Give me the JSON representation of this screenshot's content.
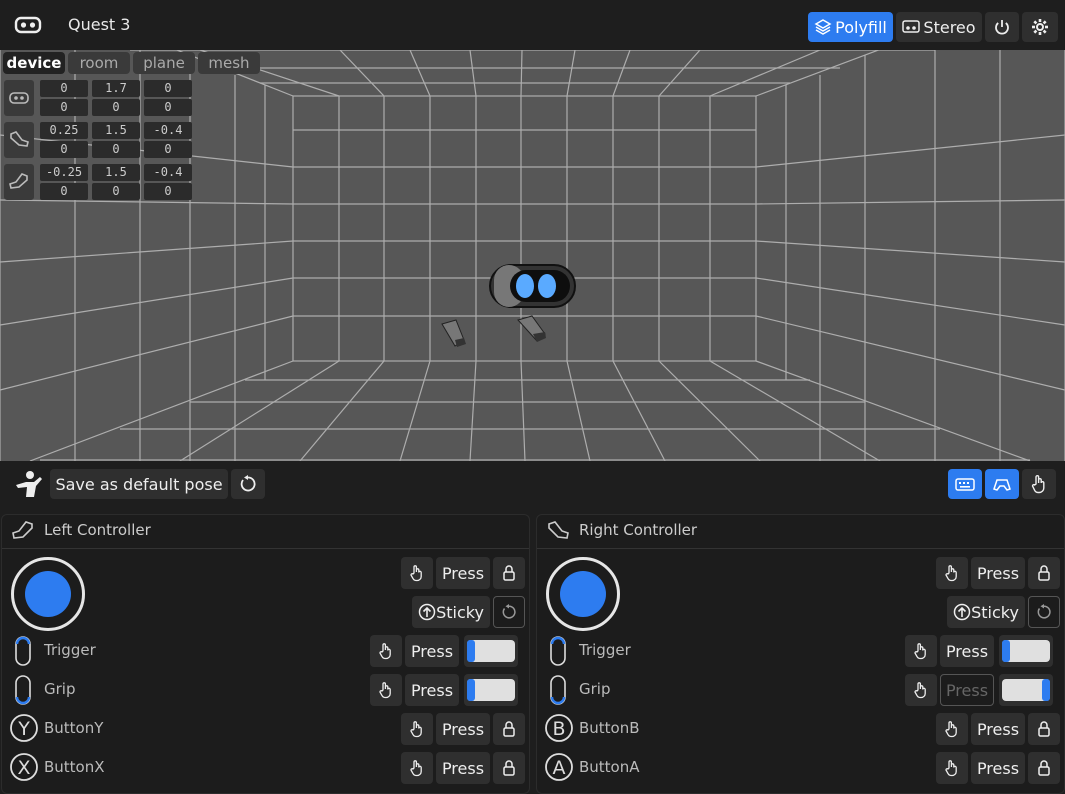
{
  "header": {
    "device_name": "Quest 3",
    "polyfill_label": "Polyfill",
    "stereo_label": "Stereo"
  },
  "viewport_tabs": [
    "device",
    "room",
    "plane",
    "mesh"
  ],
  "poses": [
    {
      "name": "headset",
      "pos": [
        "0",
        "1.7",
        "0"
      ],
      "rot": [
        "0",
        "0",
        "0"
      ]
    },
    {
      "name": "right-controller",
      "pos": [
        "0.25",
        "1.5",
        "-0.4"
      ],
      "rot": [
        "0",
        "0",
        "0"
      ]
    },
    {
      "name": "left-controller",
      "pos": [
        "-0.25",
        "1.5",
        "-0.4"
      ],
      "rot": [
        "0",
        "0",
        "0"
      ]
    }
  ],
  "pose_bar": {
    "save_label": "Save as default pose"
  },
  "left": {
    "title": "Left Controller",
    "press": "Press",
    "sticky": "Sticky",
    "buttons": [
      {
        "label": "Trigger",
        "value": 0
      },
      {
        "label": "Grip",
        "value": 0
      },
      {
        "label": "ButtonY",
        "letter": "Y"
      },
      {
        "label": "ButtonX",
        "letter": "X"
      }
    ]
  },
  "right": {
    "title": "Right Controller",
    "press": "Press",
    "sticky": "Sticky",
    "buttons": [
      {
        "label": "Trigger",
        "value": 0
      },
      {
        "label": "Grip",
        "value": 1
      },
      {
        "label": "ButtonB",
        "letter": "B"
      },
      {
        "label": "ButtonA",
        "letter": "A"
      }
    ]
  },
  "colors": {
    "accent": "#2d7cf0",
    "viewport_bg": "#575757",
    "grid": "#bdbdbd"
  }
}
